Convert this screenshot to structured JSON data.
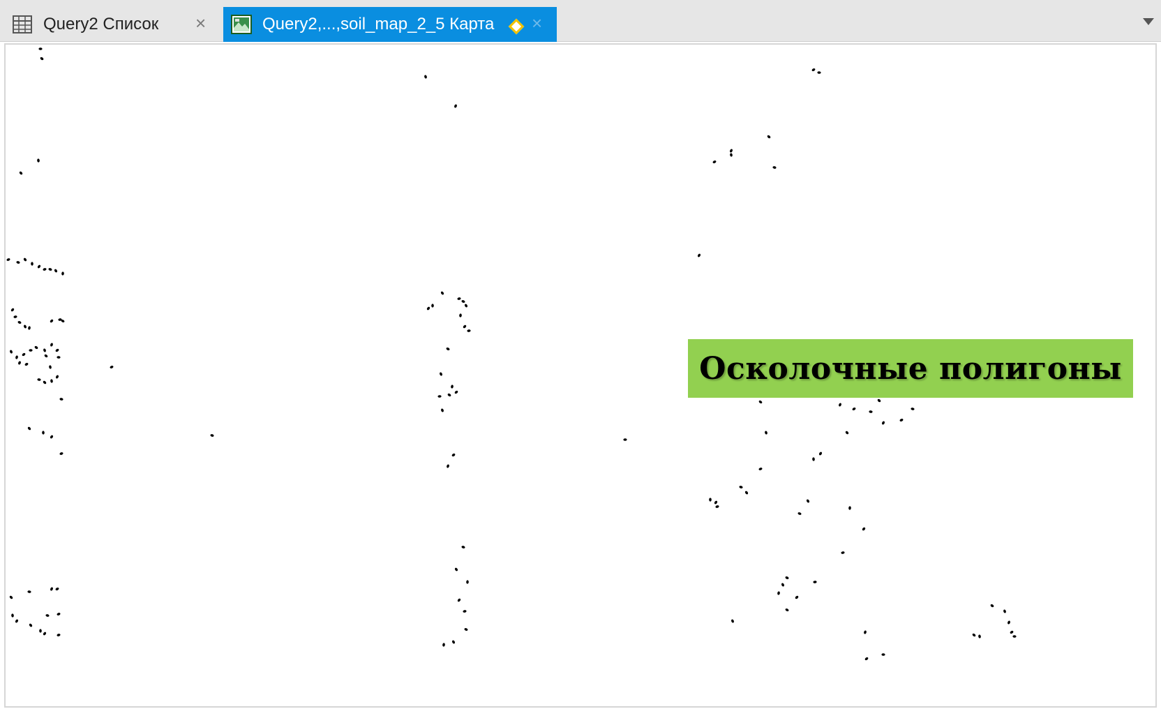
{
  "tabs": [
    {
      "label": "Query2 Список",
      "icon": "table-icon",
      "active": false,
      "close": "×"
    },
    {
      "label": "Query2,...,soil_map_2_5 Карта",
      "icon": "map-icon",
      "active": true,
      "close": "×",
      "modified_marker": "diamond-icon"
    }
  ],
  "colors": {
    "tab_active_bg": "#0a8ee0",
    "tabbar_bg": "#e6e6e6",
    "callout_bg": "#92d050",
    "sliver_fill": "#000000"
  },
  "map": {
    "content": "sliver polygons (black specks) scattered across map window"
  },
  "callout": {
    "text": "Осколочные полигоны"
  }
}
